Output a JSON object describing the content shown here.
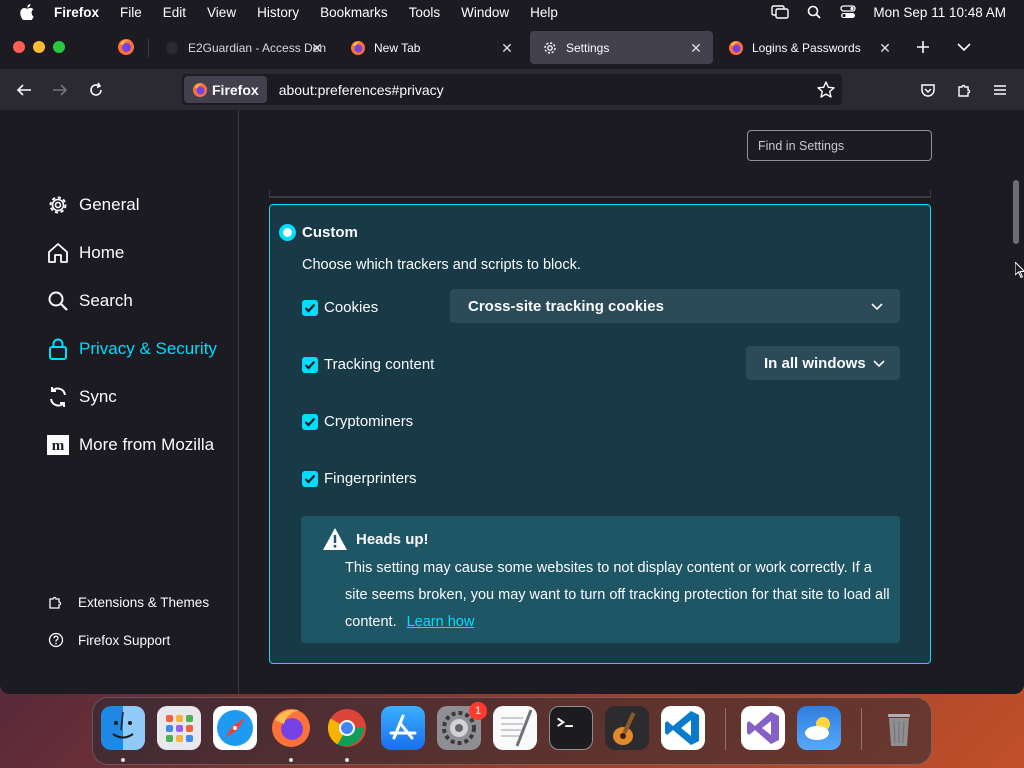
{
  "menubar": {
    "app": "Firefox",
    "items": [
      "File",
      "Edit",
      "View",
      "History",
      "Bookmarks",
      "Tools",
      "Window",
      "Help"
    ],
    "clock": "Mon Sep 11  10:48 AM"
  },
  "tabs": [
    {
      "title": "E2Guardian - Access Den",
      "icon": "e2guardian-icon"
    },
    {
      "title": "New Tab",
      "icon": "firefox-icon"
    },
    {
      "title": "Settings",
      "icon": "gear-icon",
      "active": true
    },
    {
      "title": "Logins & Passwords",
      "icon": "firefox-icon"
    }
  ],
  "urlbar": {
    "identity": "Firefox",
    "url": "about:preferences#privacy"
  },
  "sidebar": {
    "categories": [
      {
        "label": "General",
        "icon": "gear-icon"
      },
      {
        "label": "Home",
        "icon": "home-icon"
      },
      {
        "label": "Search",
        "icon": "search-icon"
      },
      {
        "label": "Privacy & Security",
        "icon": "lock-icon",
        "selected": true
      },
      {
        "label": "Sync",
        "icon": "sync-icon"
      },
      {
        "label": "More from Mozilla",
        "icon": "mozilla-icon"
      }
    ],
    "footer": [
      {
        "label": "Extensions & Themes",
        "icon": "puzzle-icon"
      },
      {
        "label": "Firefox Support",
        "icon": "help-icon"
      }
    ]
  },
  "search": {
    "placeholder": "Find in Settings"
  },
  "custom": {
    "title": "Custom",
    "description": "Choose which trackers and scripts to block.",
    "options": [
      {
        "label": "Cookies",
        "checked": true,
        "select": "Cross-site tracking cookies"
      },
      {
        "label": "Tracking content",
        "checked": true,
        "select": "In all windows"
      },
      {
        "label": "Cryptominers",
        "checked": true
      },
      {
        "label": "Fingerprinters",
        "checked": true
      }
    ],
    "warning": {
      "title": "Heads up!",
      "body": "This setting may cause some websites to not display content or work correctly. If a site seems broken, you may want to turn off tracking protection for that site to load all content.",
      "link": "Learn how"
    }
  },
  "dock": {
    "apps": [
      "finder",
      "launchpad",
      "safari",
      "firefox",
      "chrome",
      "app-store",
      "system-settings",
      "textedit",
      "terminal",
      "garageband",
      "vscode",
      "visual-studio",
      "weather",
      "trash"
    ],
    "system_settings_badge": "1"
  },
  "colors": {
    "accent": "#00ddff",
    "background": "#1c1b22",
    "panel": "#183a46"
  }
}
